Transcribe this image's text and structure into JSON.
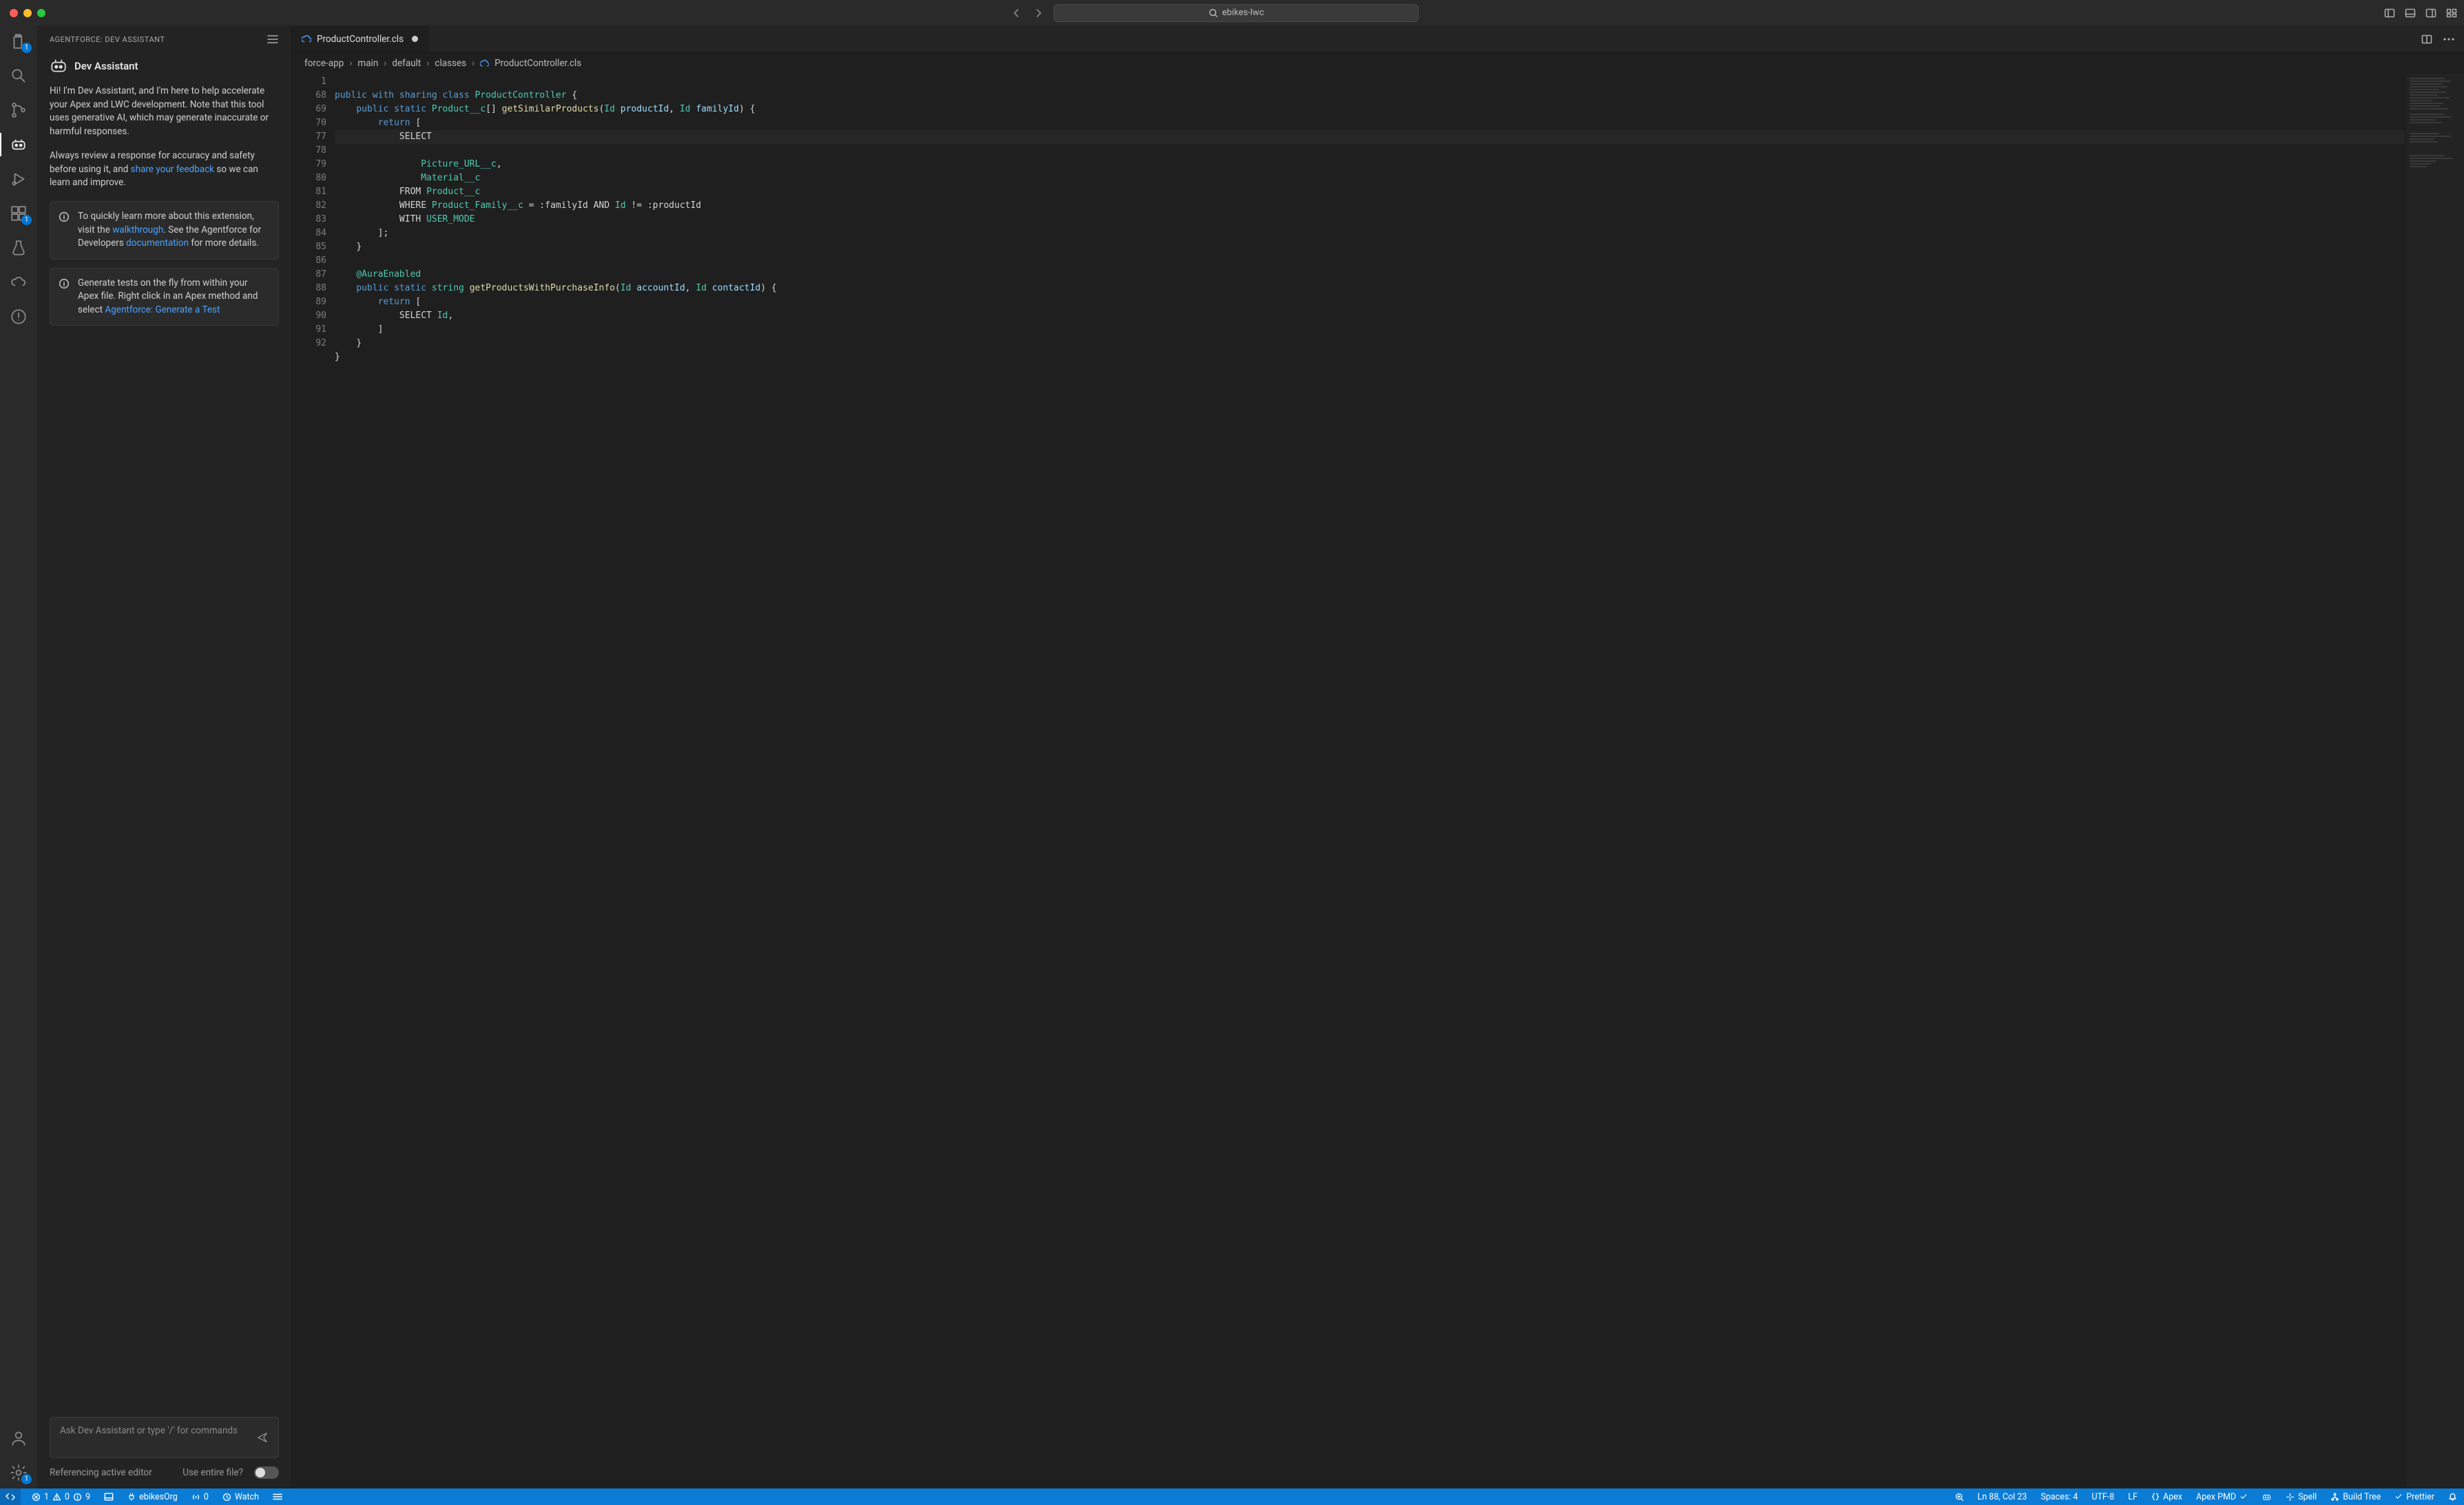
{
  "window": {
    "search": "ebikes-lwc"
  },
  "activity": {
    "explorer_badge": "1",
    "extensions_badge": "1",
    "settings_badge": "1"
  },
  "panel": {
    "header": "AGENTFORCE: DEV ASSISTANT",
    "title": "Dev Assistant",
    "intro": "Hi! I'm Dev Assistant, and I'm here to help accelerate your Apex and LWC development. Note that this tool uses generative AI, which may generate inaccurate or harmful responses.",
    "review_prefix": "Always review a response for accuracy and safety before using it, and ",
    "review_link": "share your feedback",
    "review_suffix": " so we can learn and improve.",
    "box1_prefix": "To quickly learn more about this extension, visit the ",
    "box1_link1": "walkthrough",
    "box1_mid": ". See the Agentforce for Developers ",
    "box1_link2": "documentation",
    "box1_suffix": " for more details.",
    "box2_prefix": "Generate tests on the fly from within your Apex file. Right click in an Apex method and select ",
    "box2_link": "Agentforce: Generate a Test",
    "ask_placeholder": "Ask Dev Assistant or type '/' for commands",
    "ref_label": "Referencing active editor",
    "use_file_label": "Use entire file?"
  },
  "tabs": {
    "file": "ProductController.cls"
  },
  "breadcrumb": [
    "force-app",
    "main",
    "default",
    "classes",
    "ProductController.cls"
  ],
  "code": {
    "lines": [
      "1",
      "68",
      "69",
      "70",
      "77",
      "78",
      "79",
      "80",
      "81",
      "82",
      "83",
      "84",
      "85",
      "86",
      "87",
      "88",
      "89",
      "90",
      "91",
      "92"
    ],
    "l1": {
      "kw1": "public",
      "kw2": "with sharing",
      "kw3": "class",
      "name": "ProductController",
      "brace": "{"
    },
    "l68": {
      "kw1": "public",
      "kw2": "static",
      "type": "Product__c",
      "arr": "[]",
      "fn": "getSimilarProducts",
      "p": "(",
      "t1": "Id",
      "v1": "productId",
      "c": ", ",
      "t2": "Id",
      "v2": "familyId",
      "pp": ")",
      "br": "{"
    },
    "l69": {
      "kw": "return",
      "br": "["
    },
    "l70": {
      "sel": "SELECT"
    },
    "l77": {
      "col": "Picture_URL__c",
      "c": ","
    },
    "l78": {
      "col": "Material__c"
    },
    "l79": {
      "from": "FROM",
      "tbl": "Product__c"
    },
    "l80": {
      "where": "WHERE",
      "col": "Product_Family__c",
      "eq": "= :familyId",
      "and": "AND",
      "idt": "Id",
      "neq": "!= :productId"
    },
    "l81": {
      "with": "WITH",
      "um": "USER_MODE"
    },
    "l82": {
      "close": "];"
    },
    "l83": {
      "close": "}"
    },
    "l85": {
      "ann": "@AuraEnabled"
    },
    "l86": {
      "kw1": "public",
      "kw2": "static",
      "type": "string",
      "fn": "getProductsWithPurchaseInfo",
      "p": "(",
      "t1": "Id",
      "v1": "accountId",
      "c": ", ",
      "t2": "Id",
      "v2": "contactId",
      "pp": ")",
      "br": "{"
    },
    "l87": {
      "kw": "return",
      "br": "["
    },
    "l88": {
      "sel": "SELECT",
      "col": "Id",
      "c": ","
    },
    "l89": {
      "close": "]"
    },
    "l90": {
      "close": "}"
    },
    "l91": {
      "close": "}"
    }
  },
  "status": {
    "errors": "1",
    "warnings": "0",
    "infos": "9",
    "org": "ebikesOrg",
    "ports": "0",
    "watch": "Watch",
    "pos": "Ln 88, Col 23",
    "spaces": "Spaces: 4",
    "enc": "UTF-8",
    "eol": "LF",
    "lang": "Apex",
    "pmd": "Apex PMD",
    "spell": "Spell",
    "build": "Build Tree",
    "prettier": "Prettier"
  }
}
